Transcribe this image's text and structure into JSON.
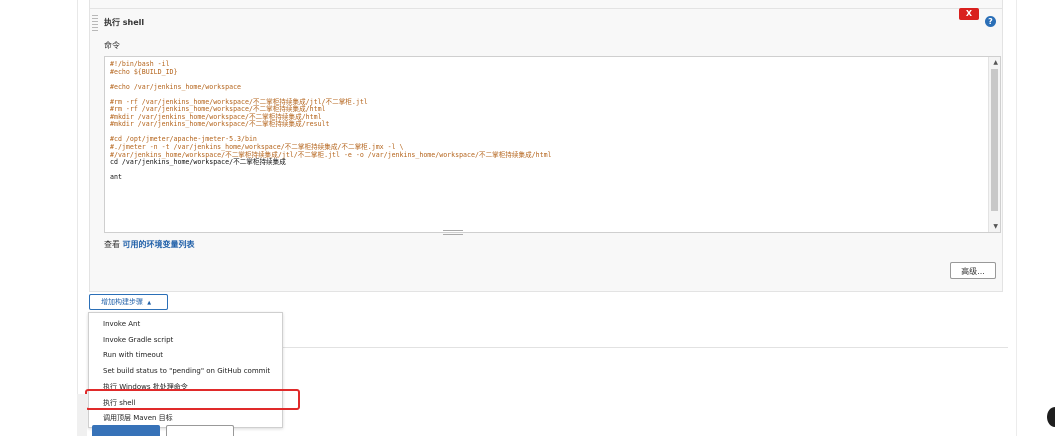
{
  "builder": {
    "title": "执行 shell",
    "delete_label": "X",
    "help_label": "?",
    "command_label": "命令",
    "code_lines": [
      {
        "text": "#!/bin/bash -il",
        "kind": "comment"
      },
      {
        "text": "#echo ${BUILD_ID}",
        "kind": "comment"
      },
      {
        "text": "",
        "kind": "plain"
      },
      {
        "text": "#echo /var/jenkins_home/workspace",
        "kind": "comment"
      },
      {
        "text": "",
        "kind": "plain"
      },
      {
        "text": "#rm -rf /var/jenkins_home/workspace/不二掌柜持续集成/jtl/不二掌柜.jtl",
        "kind": "comment"
      },
      {
        "text": "#rm -rf /var/jenkins_home/workspace/不二掌柜持续集成/html",
        "kind": "comment"
      },
      {
        "text": "#mkdir /var/jenkins_home/workspace/不二掌柜持续集成/html",
        "kind": "comment"
      },
      {
        "text": "#mkdir /var/jenkins_home/workspace/不二掌柜持续集成/result",
        "kind": "comment"
      },
      {
        "text": "",
        "kind": "plain"
      },
      {
        "text": "#cd /opt/jmeter/apache-jmeter-5.3/bin",
        "kind": "comment"
      },
      {
        "text": "#./jmeter -n -t /var/jenkins_home/workspace/不二掌柜持续集成/不二掌柜.jmx -l \\",
        "kind": "comment"
      },
      {
        "text": "#/var/jenkins_home/workspace/不二掌柜持续集成/jtl/不二掌柜.jtl -e -o /var/jenkins_home/workspace/不二掌柜持续集成/html",
        "kind": "comment"
      },
      {
        "text": "cd /var/jenkins_home/workspace/不二掌柜持续集成",
        "kind": "plain"
      },
      {
        "text": "",
        "kind": "plain"
      },
      {
        "text": "ant",
        "kind": "plain"
      }
    ],
    "env_prefix": "查看 ",
    "env_link": "可用的环境变量列表",
    "advanced_label": "高级..."
  },
  "add_step": {
    "label": "增加构建步骤",
    "arrow": "▲"
  },
  "menu": {
    "items": [
      {
        "label": "Invoke Ant"
      },
      {
        "label": "Invoke Gradle script"
      },
      {
        "label": "Run with timeout"
      },
      {
        "label": "Set build status to \"pending\" on GitHub commit"
      },
      {
        "label": "执行 Windows 批处理命令"
      },
      {
        "label": "执行 shell"
      },
      {
        "label": "调用顶层 Maven 目标"
      }
    ],
    "highlighted": "执行 shell"
  },
  "colors": {
    "comment": "#b5651d",
    "link": "#1f5fa8",
    "highlight": "#e02a2a",
    "danger": "#d9201e",
    "primary": "#3772b8"
  }
}
